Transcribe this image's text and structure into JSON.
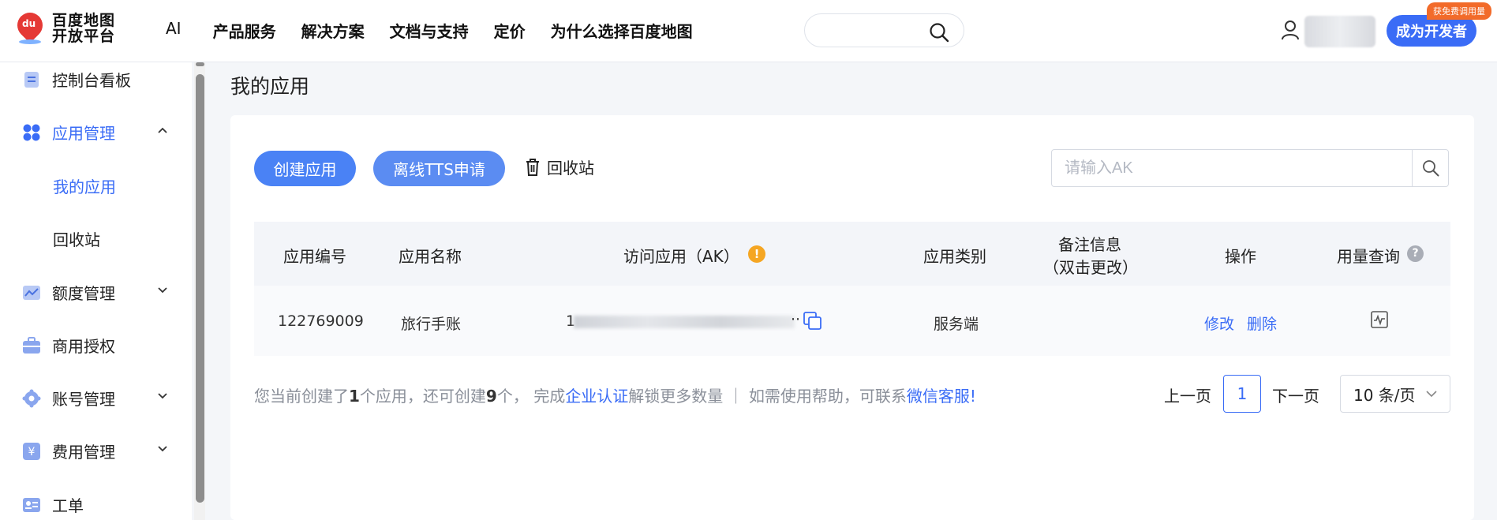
{
  "header": {
    "logo_text_line1": "百度地图",
    "logo_text_line2": "开放平台",
    "logo_pin_text": "du",
    "nav": [
      "AI",
      "产品服务",
      "解决方案",
      "文档与支持",
      "定价",
      "为什么选择百度地图"
    ],
    "developer_button": "成为开发者",
    "free_badge": "获免费调用量"
  },
  "sidebar": {
    "items": [
      {
        "label": "控制台看板"
      },
      {
        "label": "应用管理"
      },
      {
        "label": "额度管理"
      },
      {
        "label": "商用授权"
      },
      {
        "label": "账号管理"
      },
      {
        "label": "费用管理"
      },
      {
        "label": "工单"
      }
    ],
    "subitems": [
      {
        "label": "我的应用"
      },
      {
        "label": "回收站"
      }
    ]
  },
  "main": {
    "page_title": "我的应用",
    "create_button": "创建应用",
    "tts_button": "离线TTS申请",
    "recycle_label": "回收站",
    "ak_search_placeholder": "请输入AK",
    "columns": {
      "id": "应用编号",
      "name": "应用名称",
      "ak": "访问应用（AK）",
      "type": "应用类别",
      "note_line1": "备注信息",
      "note_line2": "（双击更改）",
      "ops": "操作",
      "usage": "用量查询"
    },
    "rows": [
      {
        "id": "122769009",
        "name": "旅行手账",
        "ak_prefix": "1",
        "ak_suffix": "··",
        "type": "服务端",
        "edit": "修改",
        "delete": "删除"
      }
    ],
    "footer": {
      "text1": "您当前创建了",
      "count_created": "1",
      "text2": "个应用，还可创建",
      "count_remaining": "9",
      "text3": "个，  完成",
      "link_cert": "企业认证",
      "text4": "解锁更多数量  ｜  如需使用帮助，可联系",
      "link_service": "微信客服!"
    },
    "pager": {
      "prev": "上一页",
      "current": "1",
      "next": "下一页",
      "page_size": "10 条/页"
    },
    "warn_symbol": "!",
    "help_symbol": "?"
  },
  "colors": {
    "accent": "#3a6cf6",
    "warning": "#f5a623",
    "badge": "#f26b2a"
  }
}
